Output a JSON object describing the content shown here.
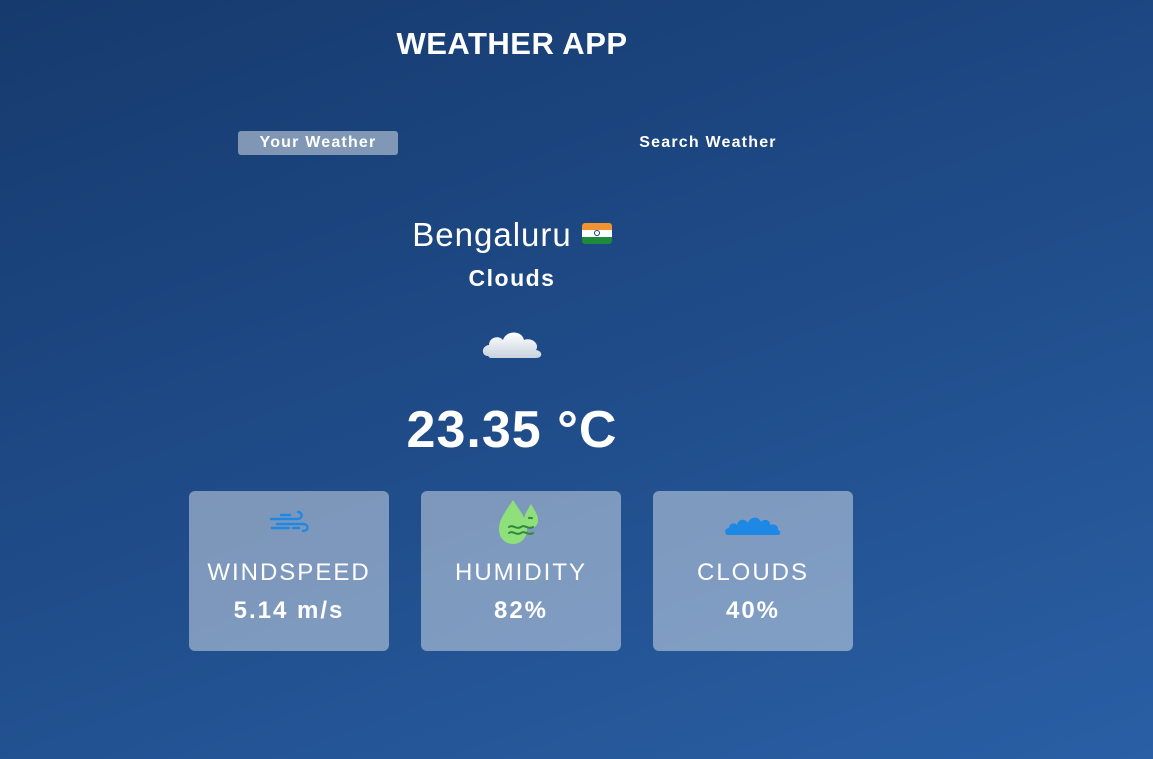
{
  "app": {
    "title": "WEATHER APP"
  },
  "tabs": [
    {
      "label": "Your Weather",
      "active": true
    },
    {
      "label": "Search Weather",
      "active": false
    }
  ],
  "current": {
    "city": "Bengaluru",
    "flag_icon": "india-flag-icon",
    "condition": "Clouds",
    "condition_icon": "cloud-icon",
    "temperature": "23.35 °C"
  },
  "stats": [
    {
      "label": "WINDSPEED",
      "value": "5.14 m/s",
      "icon": "wind-icon",
      "icon_color": "#1e88e5"
    },
    {
      "label": "HUMIDITY",
      "value": "82%",
      "icon": "humidity-drops-icon",
      "icon_color": "#8fe07a"
    },
    {
      "label": "CLOUDS",
      "value": "40%",
      "icon": "clouds-icon",
      "icon_color": "#1e88e5"
    }
  ],
  "colors": {
    "background_top": "#163a6e",
    "background_bottom": "#2a5fa5",
    "text": "#ffffff"
  }
}
